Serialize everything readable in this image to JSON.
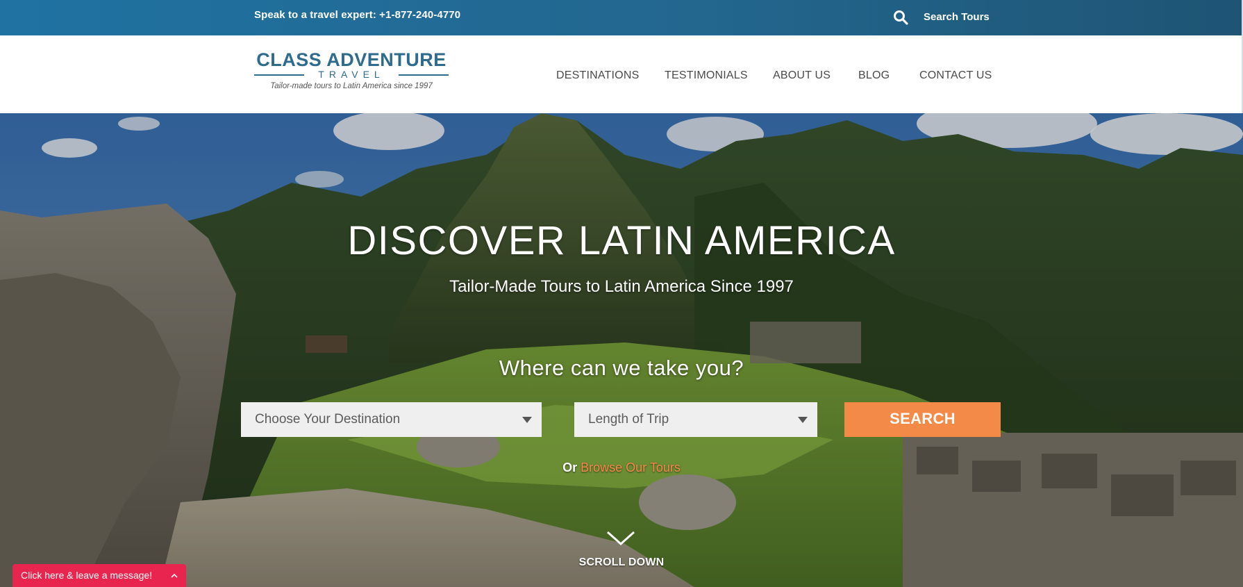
{
  "topbar": {
    "phone_text": "Speak to a travel expert: +1-877-240-4770",
    "search_label": "Search Tours",
    "icon": "search-icon"
  },
  "logo": {
    "main": "CLASS ADVENTURE",
    "sub": "TRAVEL",
    "tagline": "Tailor-made tours to Latin America since 1997"
  },
  "nav": {
    "items": [
      {
        "label": "DESTINATIONS"
      },
      {
        "label": "TESTIMONIALS"
      },
      {
        "label": "ABOUT US"
      },
      {
        "label": "BLOG"
      },
      {
        "label": "CONTACT US"
      }
    ]
  },
  "hero": {
    "title": "DISCOVER LATIN AMERICA",
    "subtitle": "Tailor-Made Tours to Latin America Since 1997",
    "question": "Where can we take you?",
    "destination_select": "Choose Your Destination",
    "length_select": "Length of Trip",
    "search_button": "SEARCH",
    "or_text": "Or",
    "browse_link": "Browse Our Tours",
    "scroll_text": "SCROLL DOWN"
  },
  "chat": {
    "label": "Click here & leave a message!",
    "icon": "chevron-up-icon"
  },
  "colors": {
    "topbar": "#23678f",
    "accent_orange": "#f48a48",
    "logo_blue": "#2e6b8c",
    "chat_red": "#e8254f"
  }
}
